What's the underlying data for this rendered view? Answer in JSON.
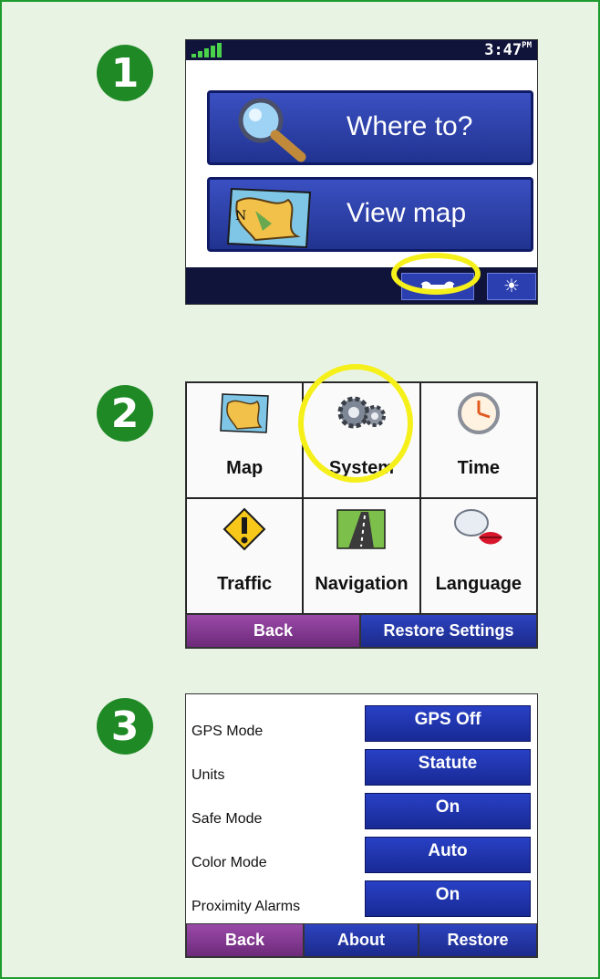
{
  "steps": [
    "1",
    "2",
    "3"
  ],
  "screen1": {
    "time": "3:47",
    "time_suffix": "PM",
    "where_to_label": "Where to?",
    "view_map_label": "View map",
    "tools_icon": "wrench-icon",
    "brightness_label": "☀"
  },
  "screen2": {
    "tiles": [
      {
        "label": "Map",
        "icon": "map-icon"
      },
      {
        "label": "System",
        "icon": "gears-icon"
      },
      {
        "label": "Time",
        "icon": "clock-icon"
      },
      {
        "label": "Traffic",
        "icon": "warning-icon"
      },
      {
        "label": "Navigation",
        "icon": "road-icon"
      },
      {
        "label": "Language",
        "icon": "speech-lips-icon"
      }
    ],
    "back_label": "Back",
    "restore_settings_label": "Restore Settings"
  },
  "screen3": {
    "rows": [
      {
        "label": "GPS Mode",
        "value": "GPS Off"
      },
      {
        "label": "Units",
        "value": "Statute"
      },
      {
        "label": "Safe Mode",
        "value": "On"
      },
      {
        "label": "Color Mode",
        "value": "Auto"
      },
      {
        "label": "Proximity Alarms",
        "value": "On"
      }
    ],
    "back_label": "Back",
    "about_label": "About",
    "restore_label": "Restore"
  },
  "colors": {
    "frame_border": "#1e9a2e",
    "background": "#e8f3e4",
    "highlight": "#f6f01a",
    "button_blue": "#2b3fb0",
    "button_purple": "#8a3b98"
  }
}
